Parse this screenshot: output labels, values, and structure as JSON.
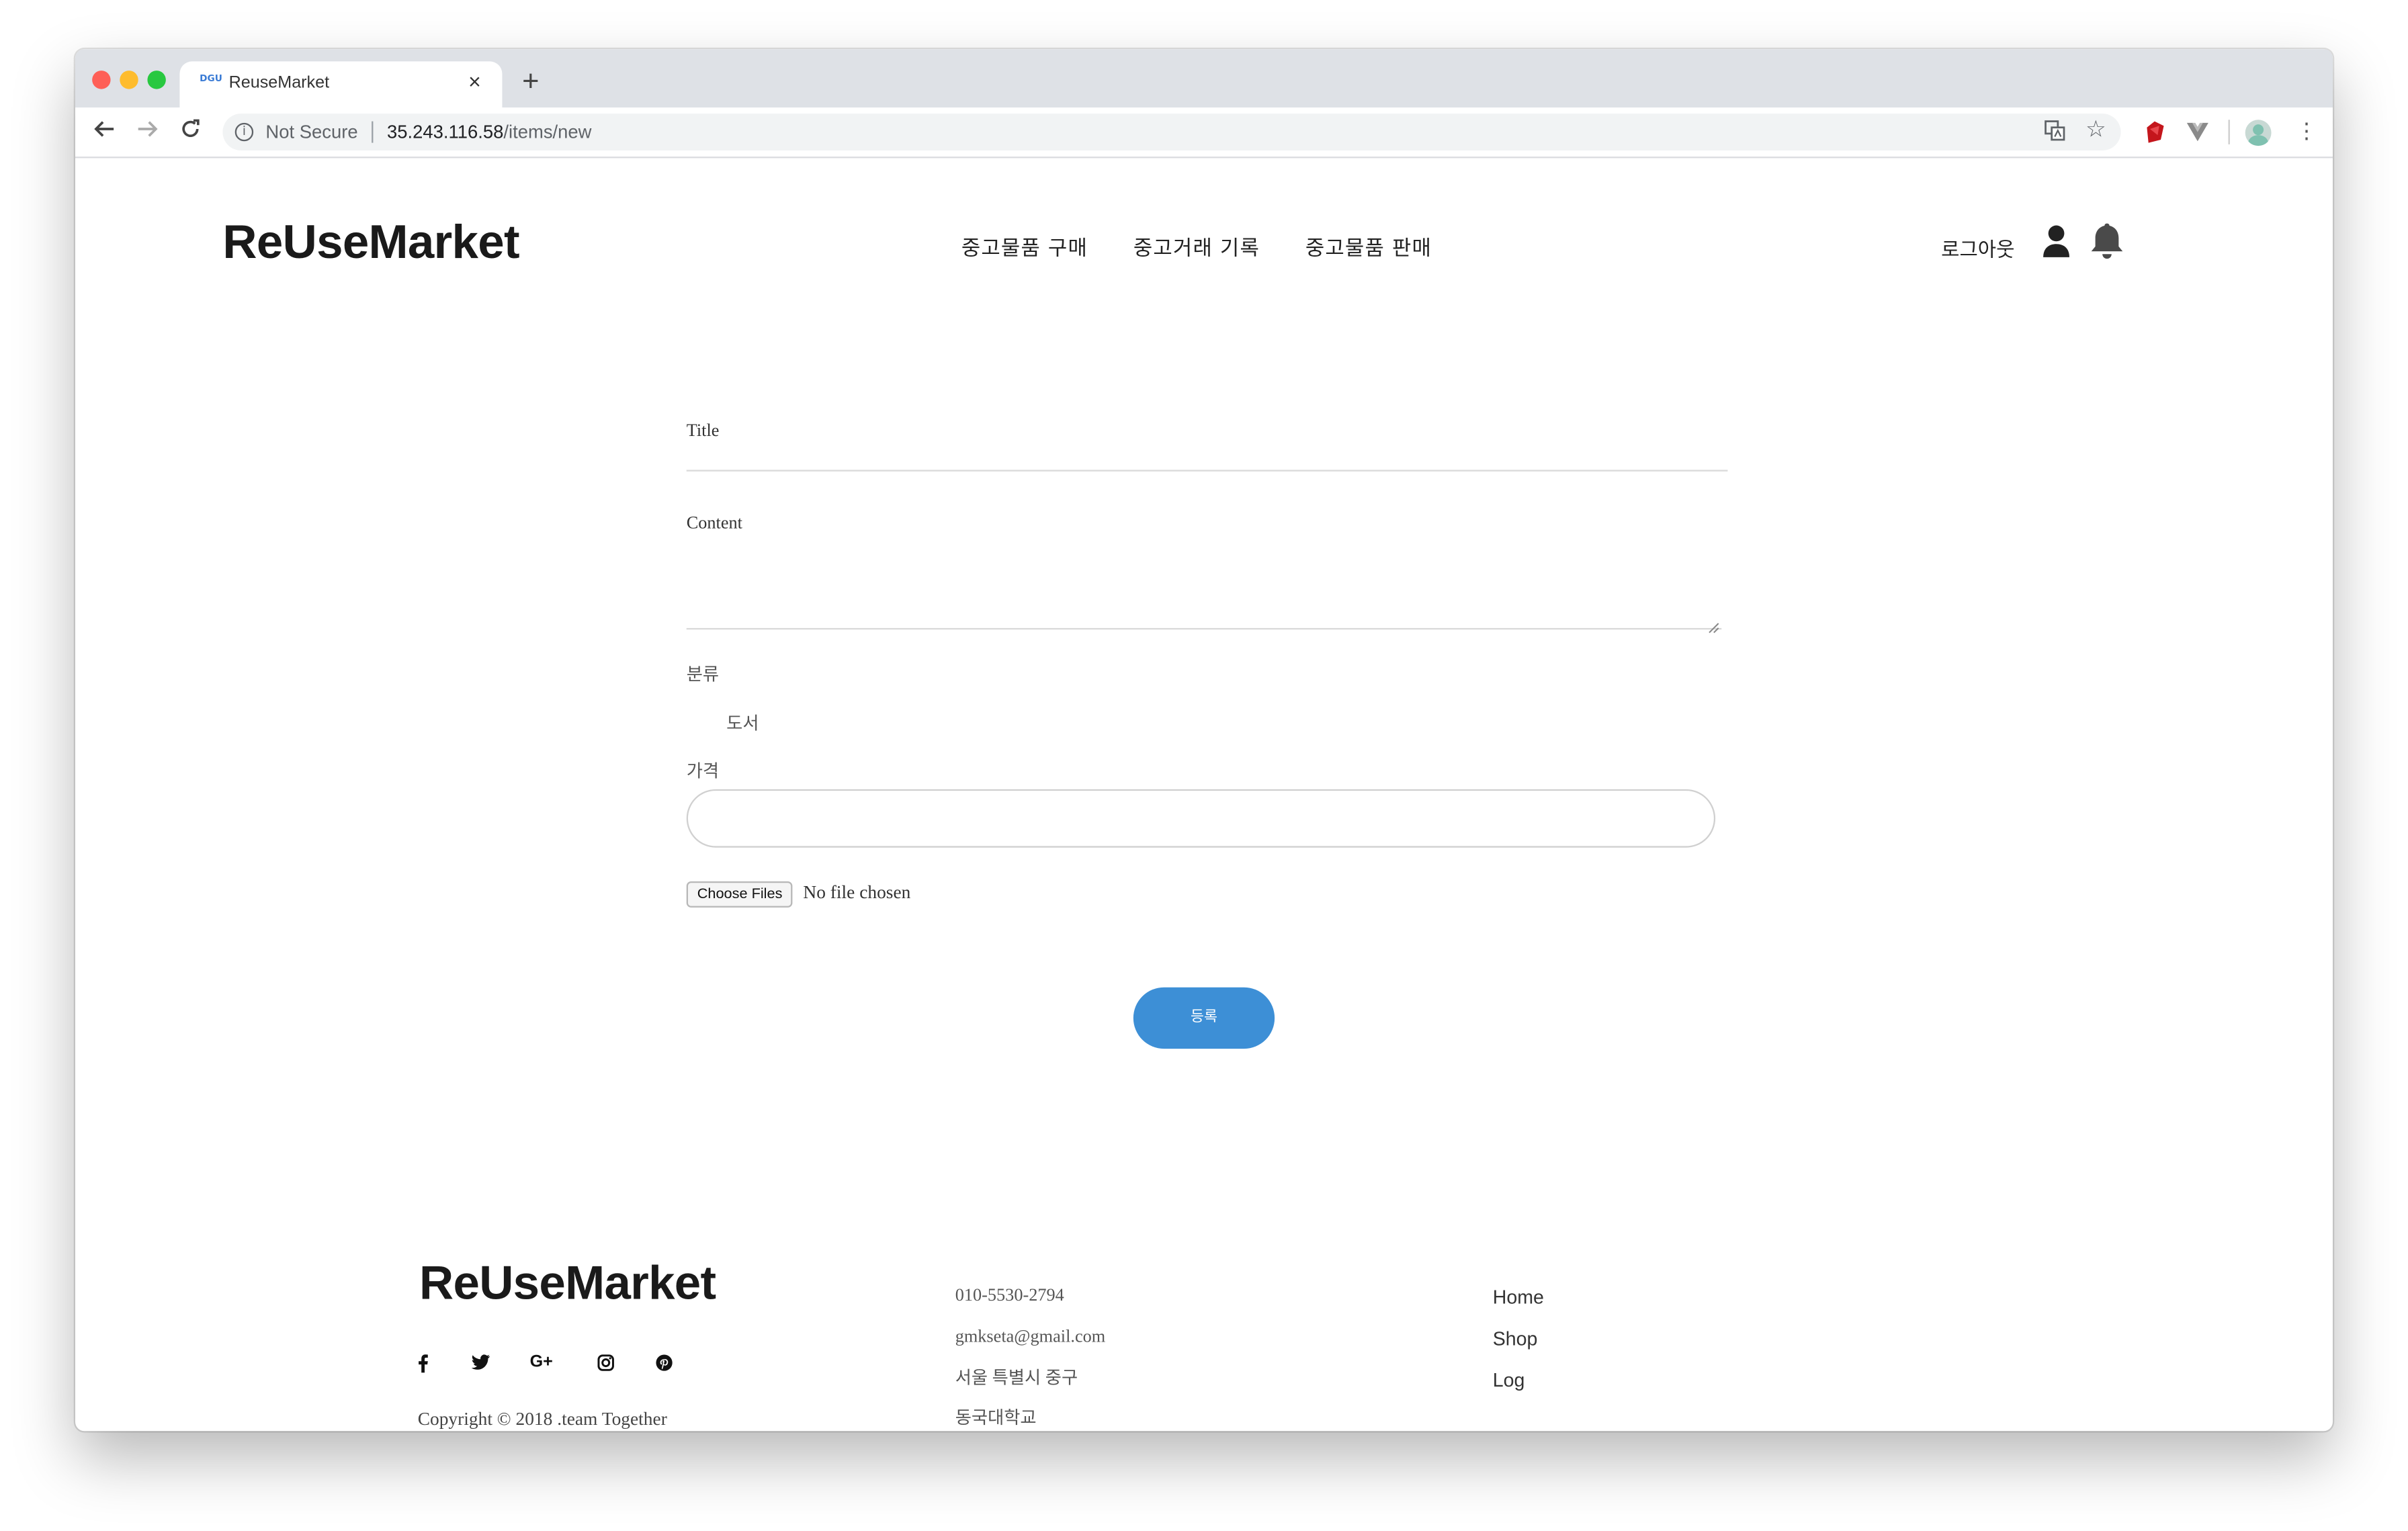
{
  "browser": {
    "tab_title": "ReuseMarket",
    "tab_favicon_text": "DGU",
    "security_label": "Not Secure",
    "url_host": "35.243.116.58",
    "url_path": "/items/new"
  },
  "header": {
    "logo": "ReUseMarket",
    "nav": [
      "중고물품 구매",
      "중고거래 기록",
      "중고물품 판매"
    ],
    "logout_label": "로그아웃"
  },
  "form": {
    "title_label": "Title",
    "title_value": "",
    "content_label": "Content",
    "content_value": "",
    "category_label": "분류",
    "category_value": "도서",
    "price_label": "가격",
    "price_value": "",
    "file_button_label": "Choose Files",
    "file_status": "No file chosen",
    "submit_label": "등록"
  },
  "footer": {
    "logo": "ReUseMarket",
    "social_icons": [
      "facebook-icon",
      "twitter-icon",
      "google-plus-icon",
      "instagram-icon",
      "pinterest-icon"
    ],
    "copyright": "Copyright © 2018 .team Together",
    "contact": {
      "phone": "010-5530-2794",
      "email": "gmkseta@gmail.com",
      "address1": "서울 특별시 중구",
      "address2": "동국대학교"
    },
    "links": [
      "Home",
      "Shop",
      "Log"
    ]
  },
  "colors": {
    "accent": "#3d8fd6",
    "tab_strip": "#dee1e6",
    "omnibox": "#f1f3f4"
  }
}
